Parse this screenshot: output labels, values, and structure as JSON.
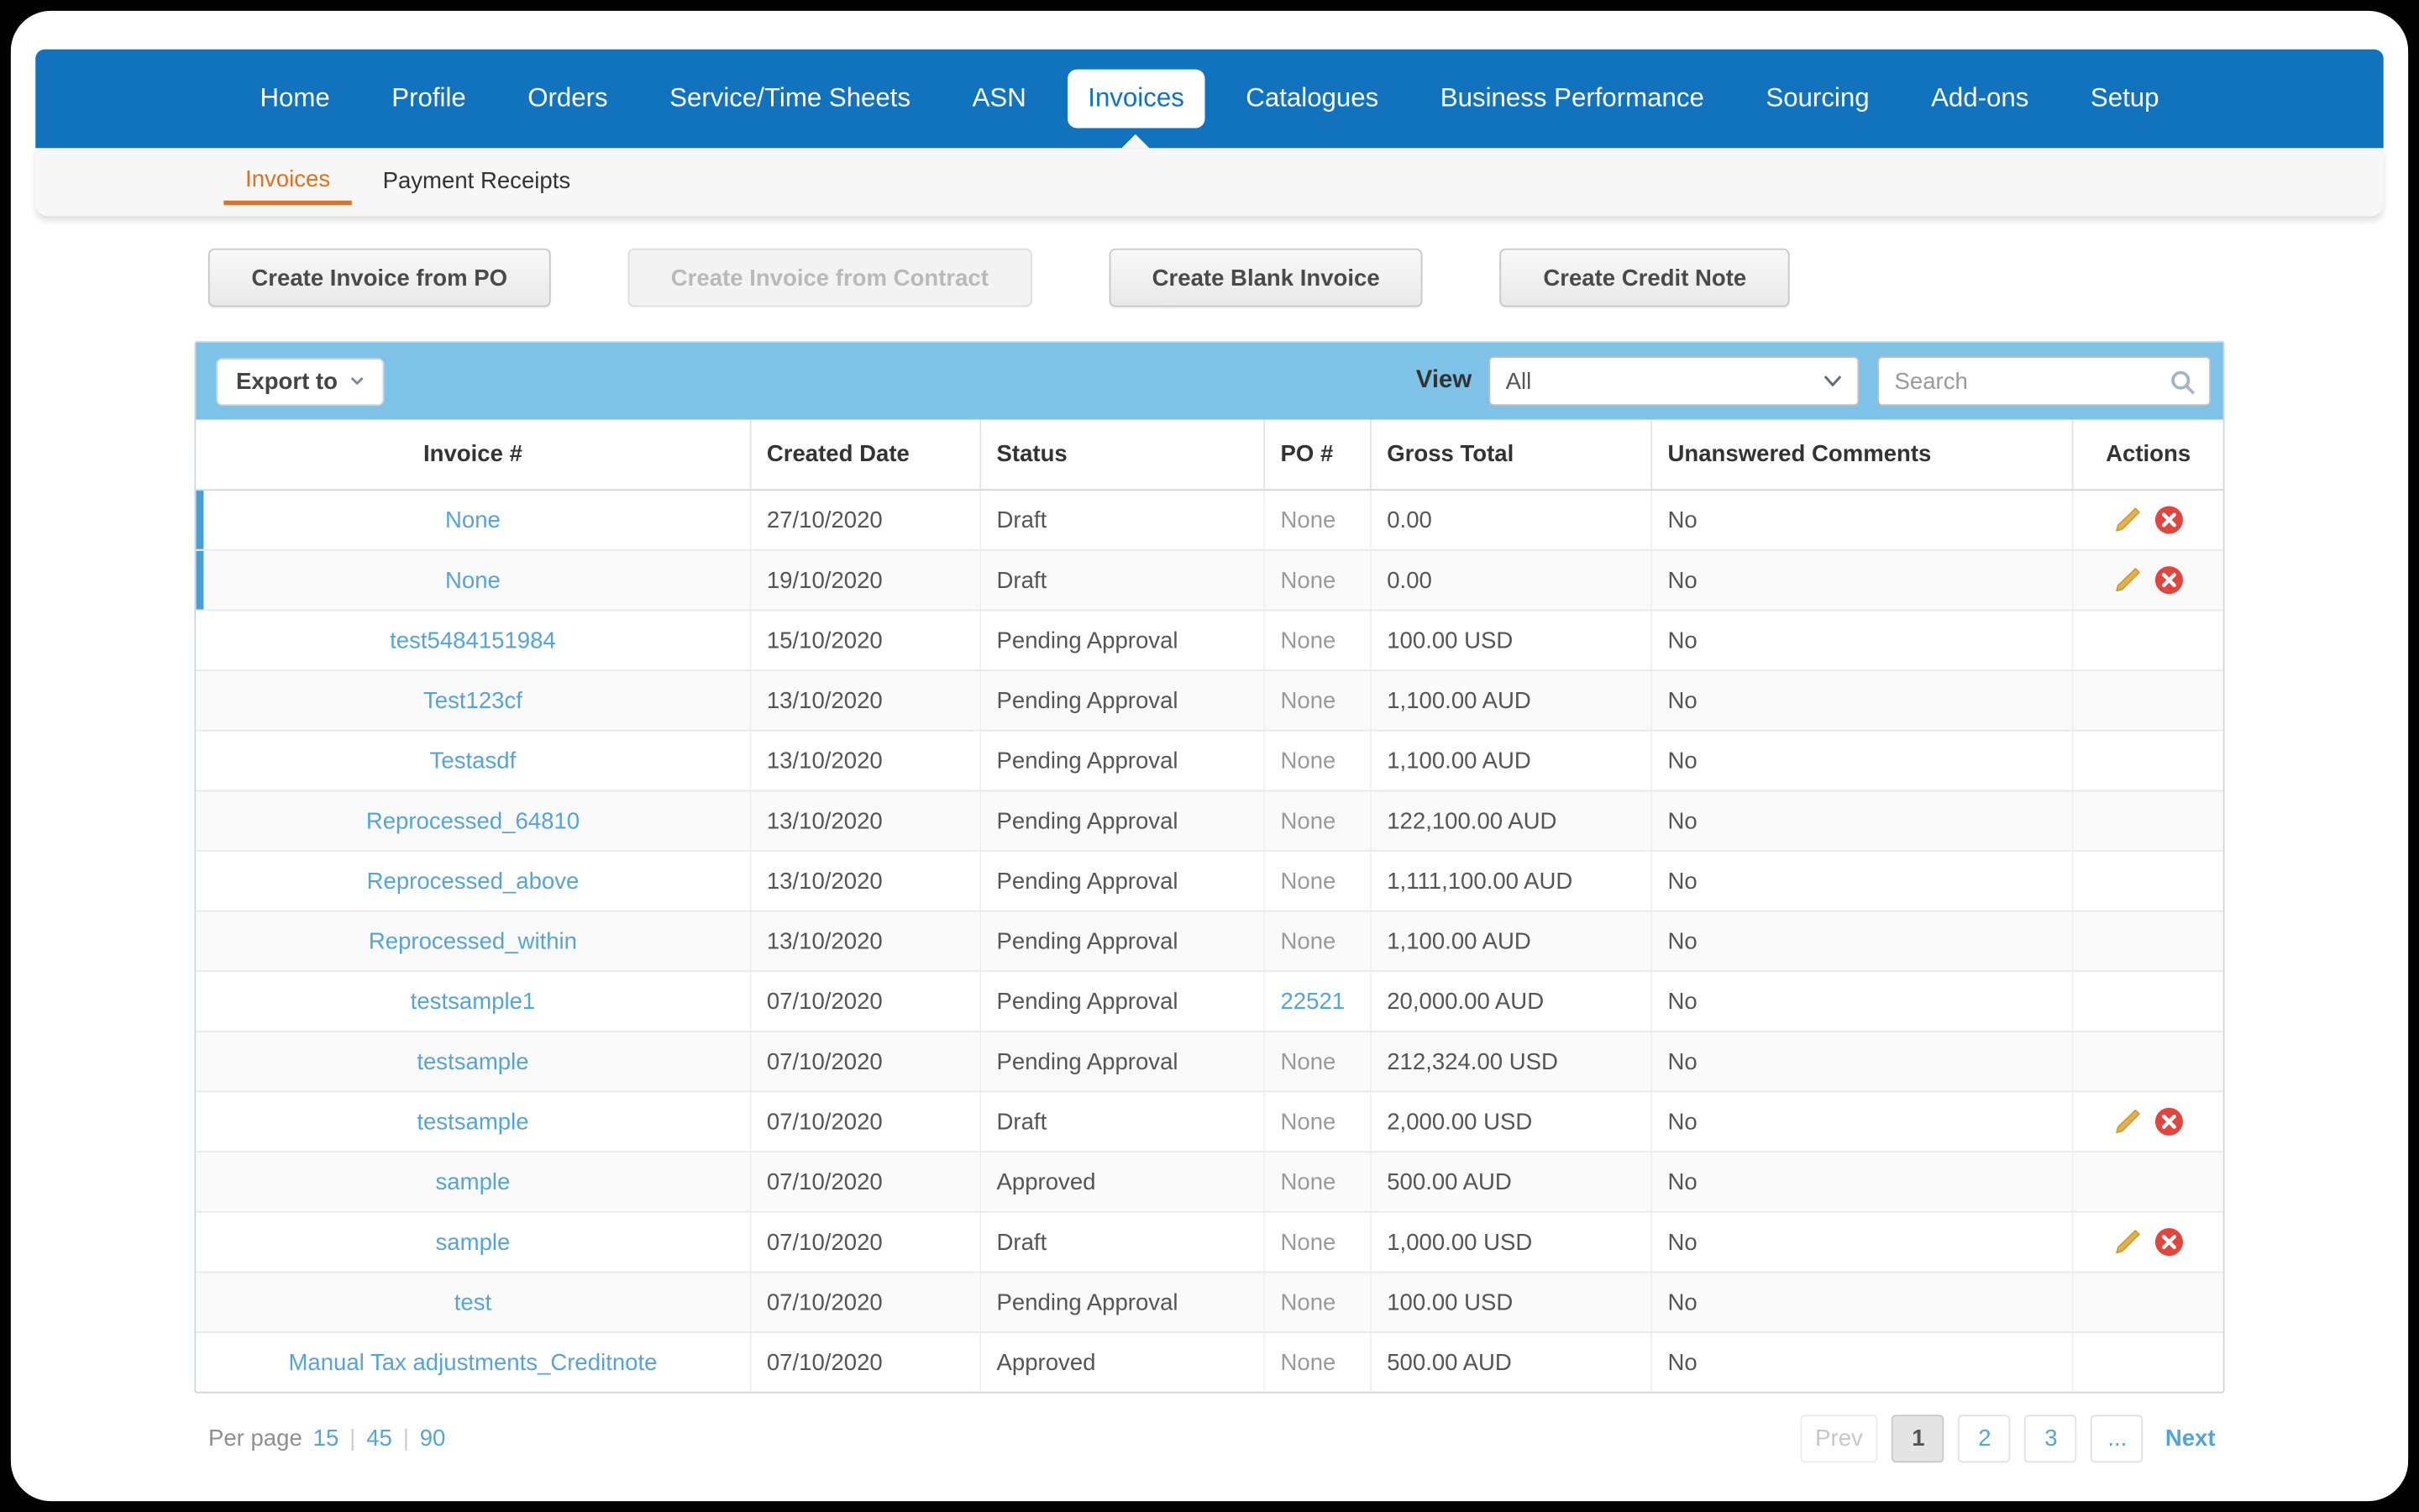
{
  "nav": {
    "active": "Invoices",
    "items": [
      {
        "label": "Home"
      },
      {
        "label": "Profile"
      },
      {
        "label": "Orders"
      },
      {
        "label": "Service/Time Sheets"
      },
      {
        "label": "ASN"
      },
      {
        "label": "Invoices"
      },
      {
        "label": "Catalogues"
      },
      {
        "label": "Business Performance"
      },
      {
        "label": "Sourcing"
      },
      {
        "label": "Add-ons"
      },
      {
        "label": "Setup"
      }
    ]
  },
  "subnav": {
    "active": "Invoices",
    "items": [
      "Invoices",
      "Payment Receipts"
    ]
  },
  "action_buttons": [
    {
      "label": "Create Invoice from PO",
      "disabled": false
    },
    {
      "label": "Create Invoice from Contract",
      "disabled": true
    },
    {
      "label": "Create Blank Invoice",
      "disabled": false
    },
    {
      "label": "Create Credit Note",
      "disabled": false
    }
  ],
  "toolbar": {
    "export_label": "Export to",
    "view_label": "View",
    "view_value": "All",
    "search_placeholder": "Search"
  },
  "table": {
    "columns": [
      "Invoice #",
      "Created Date",
      "Status",
      "PO #",
      "Gross Total",
      "Unanswered Comments",
      "Actions"
    ],
    "rows": [
      {
        "invoice": "None",
        "date": "27/10/2020",
        "status": "Draft",
        "po": "None",
        "po_link": false,
        "gross": "0.00",
        "comments": "No",
        "actions": true,
        "highlight": true
      },
      {
        "invoice": "None",
        "date": "19/10/2020",
        "status": "Draft",
        "po": "None",
        "po_link": false,
        "gross": "0.00",
        "comments": "No",
        "actions": true,
        "highlight": true
      },
      {
        "invoice": "test5484151984",
        "date": "15/10/2020",
        "status": "Pending Approval",
        "po": "None",
        "po_link": false,
        "gross": "100.00 USD",
        "comments": "No",
        "actions": false,
        "highlight": false
      },
      {
        "invoice": "Test123cf",
        "date": "13/10/2020",
        "status": "Pending Approval",
        "po": "None",
        "po_link": false,
        "gross": "1,100.00 AUD",
        "comments": "No",
        "actions": false,
        "highlight": false
      },
      {
        "invoice": "Testasdf",
        "date": "13/10/2020",
        "status": "Pending Approval",
        "po": "None",
        "po_link": false,
        "gross": "1,100.00 AUD",
        "comments": "No",
        "actions": false,
        "highlight": false
      },
      {
        "invoice": "Reprocessed_64810",
        "date": "13/10/2020",
        "status": "Pending Approval",
        "po": "None",
        "po_link": false,
        "gross": "122,100.00 AUD",
        "comments": "No",
        "actions": false,
        "highlight": false
      },
      {
        "invoice": "Reprocessed_above",
        "date": "13/10/2020",
        "status": "Pending Approval",
        "po": "None",
        "po_link": false,
        "gross": "1,111,100.00 AUD",
        "comments": "No",
        "actions": false,
        "highlight": false
      },
      {
        "invoice": "Reprocessed_within",
        "date": "13/10/2020",
        "status": "Pending Approval",
        "po": "None",
        "po_link": false,
        "gross": "1,100.00 AUD",
        "comments": "No",
        "actions": false,
        "highlight": false
      },
      {
        "invoice": "testsample1",
        "date": "07/10/2020",
        "status": "Pending Approval",
        "po": "22521",
        "po_link": true,
        "gross": "20,000.00 AUD",
        "comments": "No",
        "actions": false,
        "highlight": false
      },
      {
        "invoice": "testsample",
        "date": "07/10/2020",
        "status": "Pending Approval",
        "po": "None",
        "po_link": false,
        "gross": "212,324.00 USD",
        "comments": "No",
        "actions": false,
        "highlight": false
      },
      {
        "invoice": "testsample",
        "date": "07/10/2020",
        "status": "Draft",
        "po": "None",
        "po_link": false,
        "gross": "2,000.00 USD",
        "comments": "No",
        "actions": true,
        "highlight": false
      },
      {
        "invoice": "sample",
        "date": "07/10/2020",
        "status": "Approved",
        "po": "None",
        "po_link": false,
        "gross": "500.00 AUD",
        "comments": "No",
        "actions": false,
        "highlight": false
      },
      {
        "invoice": "sample",
        "date": "07/10/2020",
        "status": "Draft",
        "po": "None",
        "po_link": false,
        "gross": "1,000.00 USD",
        "comments": "No",
        "actions": true,
        "highlight": false
      },
      {
        "invoice": "test",
        "date": "07/10/2020",
        "status": "Pending Approval",
        "po": "None",
        "po_link": false,
        "gross": "100.00 USD",
        "comments": "No",
        "actions": false,
        "highlight": false
      },
      {
        "invoice": "Manual Tax adjustments_Creditnote",
        "date": "07/10/2020",
        "status": "Approved",
        "po": "None",
        "po_link": false,
        "gross": "500.00 AUD",
        "comments": "No",
        "actions": false,
        "highlight": false
      }
    ]
  },
  "pagination": {
    "per_page_label": "Per page",
    "separator": "|",
    "options": [
      "15",
      "45",
      "90"
    ],
    "prev": "Prev",
    "pages": [
      "1",
      "2",
      "3"
    ],
    "current": "1",
    "ellipsis": "...",
    "next": "Next"
  },
  "colors": {
    "nav_blue": "#1173bd",
    "toolbar_blue": "#7fc2e8",
    "link_blue": "#55a4d8",
    "accent_orange": "#e2711d",
    "highlight_blue": "#4a9ed6",
    "delete_red": "#e0463e",
    "pencil_gold": "#e5b04c"
  }
}
